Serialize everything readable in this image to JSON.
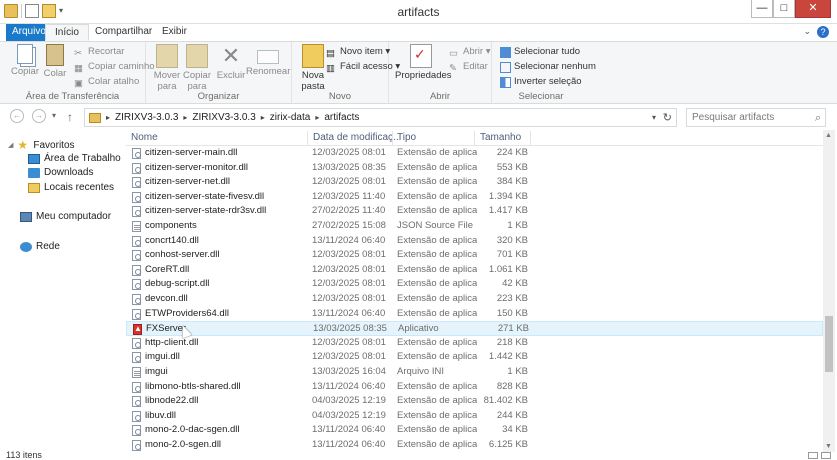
{
  "window": {
    "title": "artifacts",
    "controls": {
      "minimize": "—",
      "maximize": "□",
      "close": "✕"
    }
  },
  "tabs": [
    {
      "label": "Arquivo"
    },
    {
      "label": "Início"
    },
    {
      "label": "Compartilhar"
    },
    {
      "label": "Exibir"
    }
  ],
  "ribbon": {
    "transfer": {
      "label": "Área de Transferência",
      "copy": "Copiar",
      "paste": "Colar",
      "cut": "Recortar",
      "copy_path": "Copiar caminho",
      "paste_shortcut": "Colar atalho"
    },
    "organize": {
      "label": "Organizar",
      "move_to": "Mover\npara",
      "copy_to": "Copiar\npara",
      "delete": "Excluir",
      "rename": "Renomear"
    },
    "new": {
      "label": "Novo",
      "new_folder": "Nova\npasta",
      "new_item": "Novo item ▾",
      "easy_access": "Fácil acesso ▾"
    },
    "open": {
      "label": "Abrir",
      "properties": "Propriedades",
      "open": "Abrir ▾",
      "edit": "Editar"
    },
    "select": {
      "label": "Selecionar",
      "select_all": "Selecionar tudo",
      "select_none": "Selecionar nenhum",
      "invert": "Inverter seleção"
    }
  },
  "address": {
    "crumbs": [
      "ZIRIXV3-3.0.3",
      "ZIRIXV3-3.0.3",
      "zirix-data",
      "artifacts"
    ],
    "search_placeholder": "Pesquisar artifacts"
  },
  "nav": {
    "favorites": "Favoritos",
    "desktop": "Área de Trabalho",
    "downloads": "Downloads",
    "recent": "Locais recentes",
    "computer": "Meu computador",
    "network": "Rede"
  },
  "columns": {
    "name": "Nome",
    "date": "Data de modificaç...",
    "type": "Tipo",
    "size": "Tamanho"
  },
  "files": [
    {
      "name": "citizen-server-main.dll",
      "date": "12/03/2025 08:01",
      "type": "Extensão de aplica...",
      "size": "224 KB",
      "icon": "dll"
    },
    {
      "name": "citizen-server-monitor.dll",
      "date": "13/03/2025 08:35",
      "type": "Extensão de aplica...",
      "size": "553 KB",
      "icon": "dll"
    },
    {
      "name": "citizen-server-net.dll",
      "date": "12/03/2025 08:01",
      "type": "Extensão de aplica...",
      "size": "384 KB",
      "icon": "dll"
    },
    {
      "name": "citizen-server-state-fivesv.dll",
      "date": "12/03/2025 11:40",
      "type": "Extensão de aplica...",
      "size": "1.394 KB",
      "icon": "dll"
    },
    {
      "name": "citizen-server-state-rdr3sv.dll",
      "date": "27/02/2025 11:40",
      "type": "Extensão de aplica...",
      "size": "1.417 KB",
      "icon": "dll"
    },
    {
      "name": "components",
      "date": "27/02/2025 15:08",
      "type": "JSON Source File",
      "size": "1 KB",
      "icon": "ini"
    },
    {
      "name": "concrt140.dll",
      "date": "13/11/2024 06:40",
      "type": "Extensão de aplica...",
      "size": "320 KB",
      "icon": "dll"
    },
    {
      "name": "conhost-server.dll",
      "date": "12/03/2025 08:01",
      "type": "Extensão de aplica...",
      "size": "701 KB",
      "icon": "dll"
    },
    {
      "name": "CoreRT.dll",
      "date": "12/03/2025 08:01",
      "type": "Extensão de aplica...",
      "size": "1.061 KB",
      "icon": "dll"
    },
    {
      "name": "debug-script.dll",
      "date": "12/03/2025 08:01",
      "type": "Extensão de aplica...",
      "size": "42 KB",
      "icon": "dll"
    },
    {
      "name": "devcon.dll",
      "date": "12/03/2025 08:01",
      "type": "Extensão de aplica...",
      "size": "223 KB",
      "icon": "dll"
    },
    {
      "name": "ETWProviders64.dll",
      "date": "13/11/2024 06:40",
      "type": "Extensão de aplica...",
      "size": "150 KB",
      "icon": "dll"
    },
    {
      "name": "FXServer",
      "date": "13/03/2025 08:35",
      "type": "Aplicativo",
      "size": "271 KB",
      "icon": "app",
      "highlight": true
    },
    {
      "name": "http-client.dll",
      "date": "12/03/2025 08:01",
      "type": "Extensão de aplica...",
      "size": "218 KB",
      "icon": "dll"
    },
    {
      "name": "imgui.dll",
      "date": "12/03/2025 08:01",
      "type": "Extensão de aplica...",
      "size": "1.442 KB",
      "icon": "dll"
    },
    {
      "name": "imgui",
      "date": "13/03/2025 16:04",
      "type": "Arquivo INI",
      "size": "1 KB",
      "icon": "ini"
    },
    {
      "name": "libmono-btls-shared.dll",
      "date": "13/11/2024 06:40",
      "type": "Extensão de aplica...",
      "size": "828 KB",
      "icon": "dll"
    },
    {
      "name": "libnode22.dll",
      "date": "04/03/2025 12:19",
      "type": "Extensão de aplica...",
      "size": "81.402 KB",
      "icon": "dll"
    },
    {
      "name": "libuv.dll",
      "date": "04/03/2025 12:19",
      "type": "Extensão de aplica...",
      "size": "244 KB",
      "icon": "dll"
    },
    {
      "name": "mono-2.0-dac-sgen.dll",
      "date": "13/11/2024 06:40",
      "type": "Extensão de aplica...",
      "size": "34 KB",
      "icon": "dll"
    },
    {
      "name": "mono-2.0-sgen.dll",
      "date": "13/11/2024 06:40",
      "type": "Extensão de aplica...",
      "size": "6.125 KB",
      "icon": "dll"
    }
  ],
  "status": {
    "count": "113 itens"
  }
}
